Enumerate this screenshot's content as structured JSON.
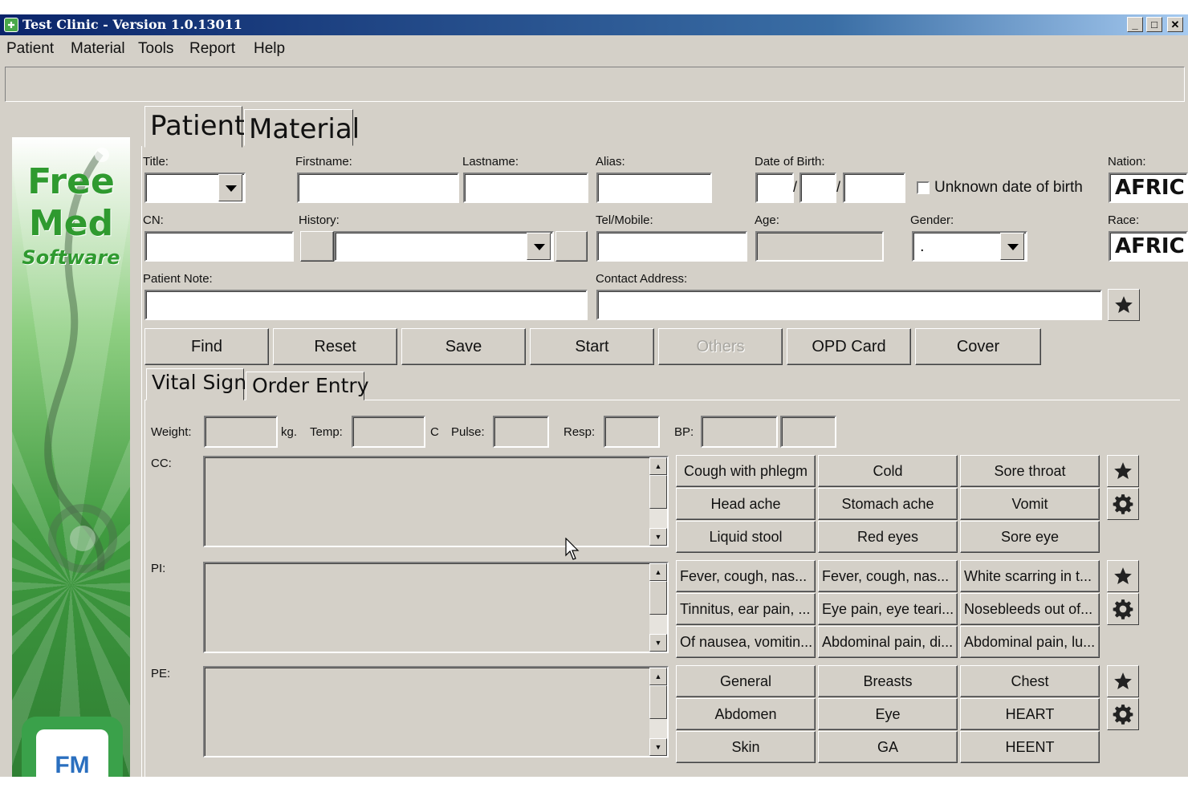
{
  "window": {
    "title": "Test Clinic - Version 1.0.13011",
    "minimize": "_",
    "maximize": "□",
    "close": "✕"
  },
  "menu": [
    "Patient",
    "Material",
    "Tools",
    "Report",
    "Help"
  ],
  "logo": {
    "line1": "Free",
    "line2": "Med",
    "line3": "Software",
    "badge": "FM"
  },
  "top_tabs": [
    "Patient",
    "Material"
  ],
  "form": {
    "title_label": "Title:",
    "firstname_label": "Firstname:",
    "lastname_label": "Lastname:",
    "alias_label": "Alias:",
    "dob_label": "Date of Birth:",
    "dob_sep": "/",
    "unknown_dob_label": "Unknown date of birth",
    "nation_label": "Nation:",
    "nation_value": "AFRIC",
    "cn_label": "CN:",
    "history_label": "History:",
    "tel_label": "Tel/Mobile:",
    "age_label": "Age:",
    "gender_label": "Gender:",
    "gender_value": ".",
    "race_label": "Race:",
    "race_value": "AFRIC",
    "note_label": "Patient Note:",
    "address_label": "Contact Address:"
  },
  "actions": [
    "Find",
    "Reset",
    "Save",
    "Start",
    "Others",
    "OPD Card",
    "Cover"
  ],
  "sub_tabs": [
    "Vital Sign",
    "Order Entry"
  ],
  "vitals": {
    "weight": "Weight:",
    "kg": "kg.",
    "temp": "Temp:",
    "c": "C",
    "pulse": "Pulse:",
    "resp": "Resp:",
    "bp": "BP:"
  },
  "sections": {
    "cc": "CC:",
    "pi": "PI:",
    "pe": "PE:"
  },
  "cc_buttons": [
    "Cough with phlegm",
    "Cold",
    "Sore throat",
    "Head ache",
    "Stomach ache",
    "Vomit",
    "Liquid stool",
    "Red eyes",
    "Sore eye"
  ],
  "pi_buttons": [
    "Fever, cough, nas...",
    "Fever, cough, nas...",
    "White scarring in t...",
    "Tinnitus, ear pain, ...",
    "Eye pain, eye teari...",
    "Nosebleeds out of...",
    "Of nausea, vomitin...",
    "Abdominal pain, di...",
    "Abdominal pain, lu..."
  ],
  "pe_buttons": [
    "General",
    "Breasts",
    "Chest",
    "Abdomen",
    "Eye",
    "HEART",
    "Skin",
    "GA",
    "HEENT"
  ]
}
